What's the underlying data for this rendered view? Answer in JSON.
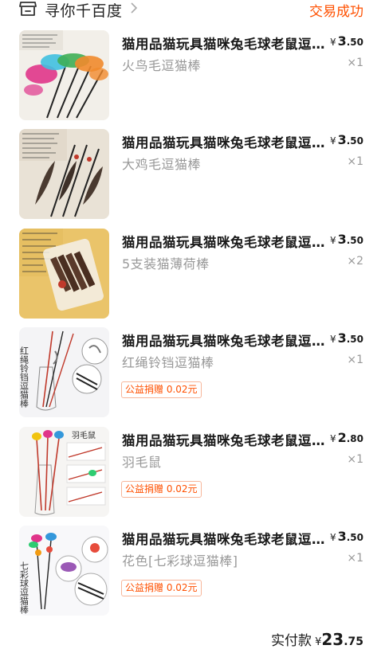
{
  "header": {
    "shop_name": "寻你千百度",
    "status": "交易成功"
  },
  "items": [
    {
      "title": "猫用品猫玩具猫咪兔毛球老鼠逗猫棒",
      "price_int": "3",
      "price_dec": ".50",
      "spec": "火鸟毛逗猫棒",
      "qty": "×1",
      "charity": ""
    },
    {
      "title": "猫用品猫玩具猫咪兔毛球老鼠逗猫棒",
      "price_int": "3",
      "price_dec": ".50",
      "spec": "大鸡毛逗猫棒",
      "qty": "×1",
      "charity": ""
    },
    {
      "title": "猫用品猫玩具猫咪兔毛球老鼠逗猫棒",
      "price_int": "3",
      "price_dec": ".50",
      "spec": "5支装猫薄荷棒",
      "qty": "×2",
      "charity": ""
    },
    {
      "title": "猫用品猫玩具猫咪兔毛球老鼠逗猫棒",
      "price_int": "3",
      "price_dec": ".50",
      "spec": "红绳铃铛逗猫棒",
      "qty": "×1",
      "charity": "公益捐赠 0.02元"
    },
    {
      "title": "猫用品猫玩具猫咪兔毛球老鼠逗猫棒",
      "price_int": "2",
      "price_dec": ".80",
      "spec": "羽毛鼠",
      "qty": "×1",
      "charity": "公益捐赠 0.02元"
    },
    {
      "title": "猫用品猫玩具猫咪兔毛球老鼠逗猫棒",
      "price_int": "3",
      "price_dec": ".50",
      "spec": "花色[七彩球逗猫棒]",
      "qty": "×1",
      "charity": "公益捐赠 0.02元"
    }
  ],
  "currency_symbol": "¥",
  "thumb_text": {
    "item4_vertical": "红绳铃铛逗猫棒",
    "item5_label": "羽毛鼠",
    "item6_vertical": "七彩球逗猫棒"
  },
  "total": {
    "label": "实付款",
    "amount_int": "23",
    "amount_dec": ".75"
  },
  "colors": {
    "accent": "#ff5000",
    "muted": "#999999"
  }
}
